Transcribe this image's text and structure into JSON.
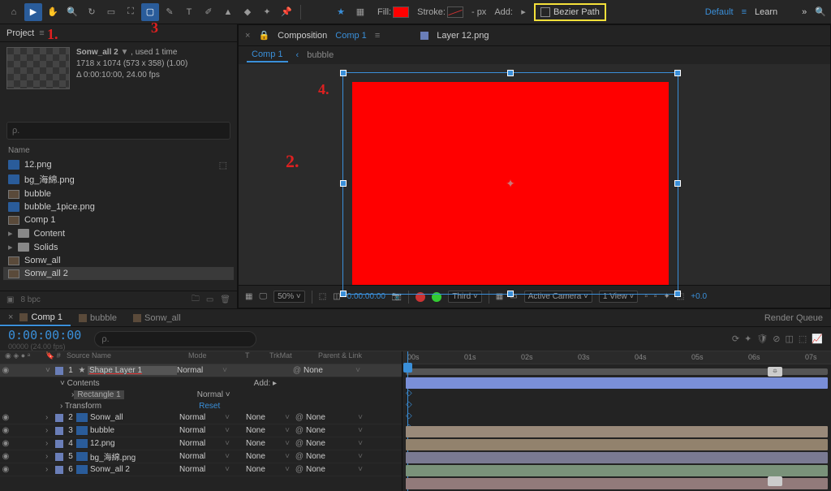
{
  "toolbar": {
    "fill_label": "Fill:",
    "stroke_label": "Stroke:",
    "stroke_px": "- px",
    "add_label": "Add:",
    "bezier_label": "Bezier Path",
    "default_label": "Default",
    "learn_label": "Learn"
  },
  "project": {
    "title": "Project",
    "selected": {
      "name": "Sonw_all 2",
      "used": ", used 1 time",
      "dims": "1718 x 1074  (573 x 358) (1.00)",
      "dur": "Δ 0:00:10:00, 24.00 fps"
    },
    "search_placeholder": "ρ.",
    "name_col": "Name",
    "items": [
      {
        "name": "12.png",
        "type": "file"
      },
      {
        "name": "bg_海綿.png",
        "type": "file"
      },
      {
        "name": "bubble",
        "type": "comp"
      },
      {
        "name": "bubble_1pice.png",
        "type": "file"
      },
      {
        "name": "Comp 1",
        "type": "comp"
      },
      {
        "name": "Content",
        "type": "folder"
      },
      {
        "name": "Solids",
        "type": "folder"
      },
      {
        "name": "Sonw_all",
        "type": "comp"
      },
      {
        "name": "Sonw_all 2",
        "type": "comp",
        "sel": true
      }
    ],
    "bpc": "8 bpc"
  },
  "comp": {
    "tab_label": "Composition",
    "tab_name": "Comp 1",
    "layer_tab": "Layer  12.png",
    "crumb_active": "Comp 1",
    "crumb_2": "bubble"
  },
  "viewer_foot": {
    "zoom": "50%",
    "time": "0:00:00:00",
    "res": "Third",
    "camera": "Active Camera",
    "view": "1 View",
    "exp": "+0.0"
  },
  "timeline": {
    "tabs": [
      "Comp 1",
      "bubble",
      "Sonw_all"
    ],
    "render_queue": "Render Queue",
    "timecode": "0:00:00:00",
    "tc_sub": "00000 (24.00 fps)",
    "cols": {
      "src": "Source Name",
      "mode": "Mode",
      "t": "T",
      "trk": "TrkMat",
      "par": "Parent & Link"
    },
    "add_label": "Add:",
    "layers": [
      {
        "n": "1",
        "name": "Shape Layer 1",
        "mode": "Normal",
        "trk": "",
        "par": "None",
        "star": true,
        "sel": true
      },
      {
        "n": "2",
        "name": "Sonw_all",
        "mode": "Normal",
        "trk": "None",
        "par": "None"
      },
      {
        "n": "3",
        "name": "bubble",
        "mode": "Normal",
        "trk": "None",
        "par": "None"
      },
      {
        "n": "4",
        "name": "12.png",
        "mode": "Normal",
        "trk": "None",
        "par": "None"
      },
      {
        "n": "5",
        "name": "bg_海綿.png",
        "mode": "Normal",
        "trk": "None",
        "par": "None"
      },
      {
        "n": "6",
        "name": "Sonw_all 2",
        "mode": "Normal",
        "trk": "None",
        "par": "None"
      }
    ],
    "contents": "Contents",
    "rect": "Rectangle 1",
    "rect_mode": "Normal",
    "transform": "Transform",
    "reset": "Reset",
    "ruler": [
      "00s",
      "01s",
      "02s",
      "03s",
      "04s",
      "05s",
      "06s",
      "07s"
    ]
  },
  "annot": {
    "a1": "1.",
    "a2": "2.",
    "a3": "3",
    "a4": "4."
  }
}
